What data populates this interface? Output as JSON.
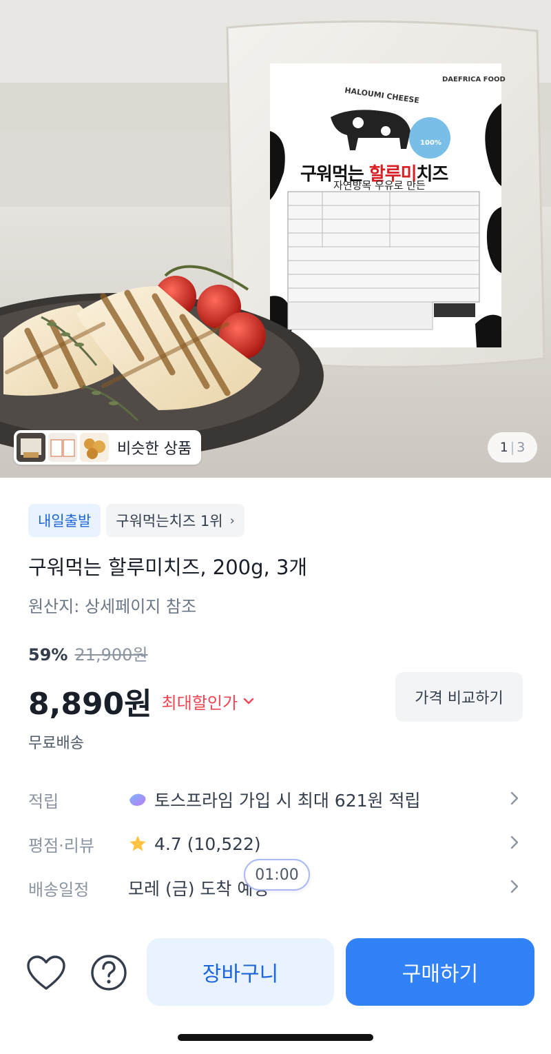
{
  "hero": {
    "package_brand": "DAEFRICA FOOD",
    "package_arc_text": "HALOUMI CHEESE",
    "package_title_prefix": "구워먹는 ",
    "package_title_highlight": "할루미",
    "package_title_suffix": "치즈",
    "package_subtitle": "자연방목 우유로 만든",
    "package_badge": "100%",
    "similar_label": "비슷한 상품",
    "page_current": "1",
    "page_sep": "|",
    "page_total": "3"
  },
  "tags": {
    "delivery": "내일출발",
    "ranking": "구워먹는치즈 1위",
    "ranking_chevron": "›"
  },
  "product": {
    "title": "구워먹는 할루미치즈, 200g, 3개",
    "origin": "원산지: 상세페이지 참조",
    "discount_rate": "59%",
    "original_price": "21,900원",
    "price": "8,890원",
    "max_discount_label": "최대할인가",
    "compare_label": "가격 비교하기",
    "shipping": "무료배송"
  },
  "info": {
    "points_label": "적립",
    "points_value": "토스프라임 가입 시 최대 621원 적립",
    "rating_label": "평점·리뷰",
    "rating_value": "4.7 (10,522)",
    "delivery_label": "배송일정",
    "delivery_value": "모레 (금) 도착 예정",
    "chevron": "›",
    "timer": "01:00"
  },
  "bottom": {
    "cart_label": "장바구니",
    "buy_label": "구매하기"
  },
  "icons": {
    "heart": "heart-icon",
    "question": "question-icon",
    "star": "star-icon",
    "toss_prime": "toss-prime-icon"
  },
  "colors": {
    "accent_blue": "#3182f6",
    "light_blue": "#e8f3ff",
    "discount_red": "#f04452",
    "star_yellow": "#ffc342"
  }
}
